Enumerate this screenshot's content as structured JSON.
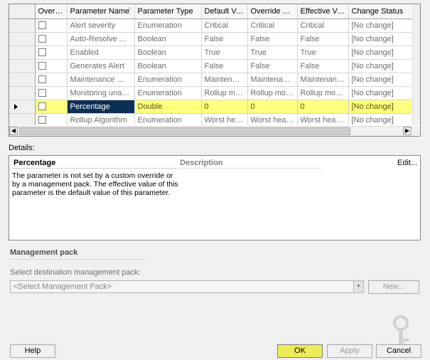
{
  "grid": {
    "columns": [
      "Override",
      "Parameter Name",
      "Parameter Type",
      "Default Value",
      "Override Value",
      "Effective Value",
      "Change Status"
    ],
    "sort_glyph": "^",
    "rows": [
      {
        "name": "Alert severity",
        "type": "Enumeration",
        "default": "Critical",
        "override": "Critical",
        "effective": "Critical",
        "status": "[No change]"
      },
      {
        "name": "Auto-Resolve Alert",
        "type": "Boolean",
        "default": "False",
        "override": "False",
        "effective": "False",
        "status": "[No change]"
      },
      {
        "name": "Enabled",
        "type": "Boolean",
        "default": "True",
        "override": "True",
        "effective": "True",
        "status": "[No change]"
      },
      {
        "name": "Generates Alert",
        "type": "Boolean",
        "default": "False",
        "override": "False",
        "effective": "False",
        "status": "[No change]"
      },
      {
        "name": "Maintenance mode",
        "type": "Enumeration",
        "default": "Maintenanc...",
        "override": "Maintenance ...",
        "effective": "Maintenance ...",
        "status": "[No change]"
      },
      {
        "name": "Monitoring unavaila...",
        "type": "Enumeration",
        "default": "Rollup monit...",
        "override": "Rollup monito...",
        "effective": "Rollup monitor...",
        "status": "[No change]"
      },
      {
        "name": "Percentage",
        "type": "Double",
        "default": "0",
        "override": "0",
        "effective": "0",
        "status": "[No change]",
        "selected": true
      },
      {
        "name": "Rollup Algorithm",
        "type": "Enumeration",
        "default": "Worst health...",
        "override": "Worst health ...",
        "effective": "Worst health s...",
        "status": "[No change]"
      }
    ]
  },
  "details": {
    "label": "Details:",
    "title": "Percentage",
    "description_header": "Description",
    "edit_link": "Edit...",
    "text": "The parameter is not set by a custom override or by a management pack. The effective value of this parameter is the default value of this parameter."
  },
  "management_pack": {
    "heading": "Management pack",
    "select_label": "Select destination management pack:",
    "select_placeholder": "<Select Management Pack>",
    "new_button": "New..."
  },
  "buttons": {
    "help": "Help",
    "ok": "OK",
    "apply": "Apply",
    "cancel": "Cancel"
  },
  "colors": {
    "selected_row": "#ffff80",
    "selected_cell": "#0c2f55",
    "ok_focus": "#ecec5a"
  }
}
